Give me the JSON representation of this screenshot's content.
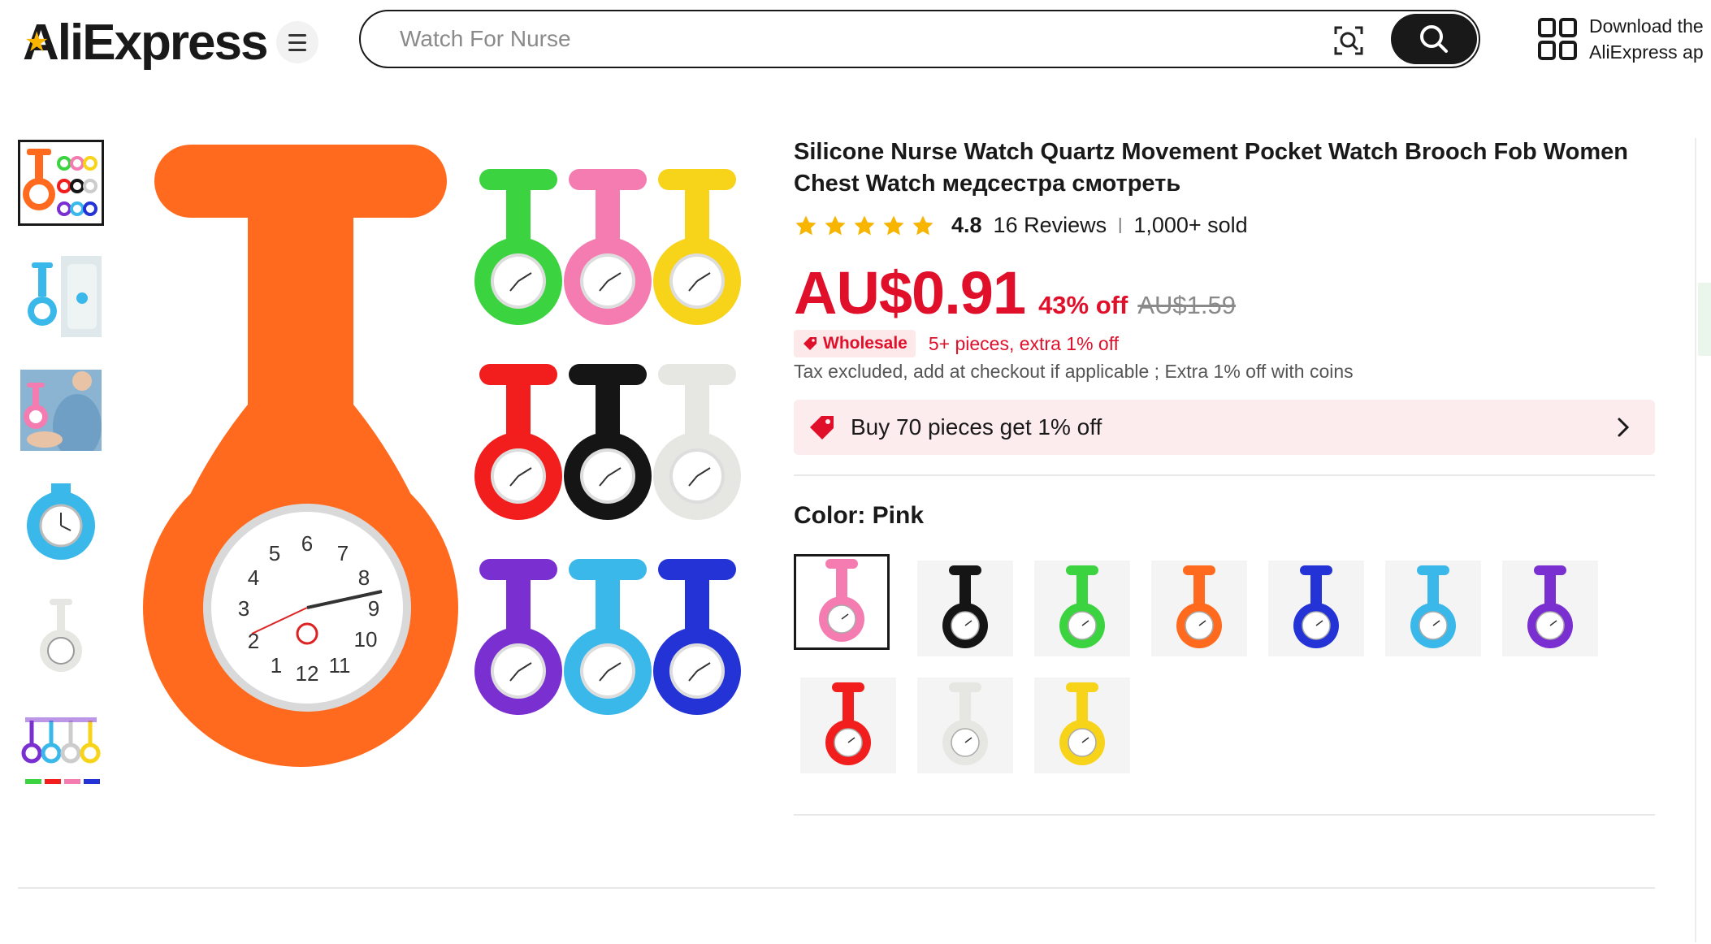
{
  "header": {
    "logo_text": "AliExpress",
    "search_placeholder": "Watch For Nurse",
    "download_line1": "Download the",
    "download_line2": "AliExpress ap"
  },
  "thumbnails": [
    {
      "name": "thumb-multi-watches",
      "active": true
    },
    {
      "name": "thumb-blue-watch-worn",
      "active": false
    },
    {
      "name": "thumb-pink-watch-worn",
      "active": false
    },
    {
      "name": "thumb-blue-watch",
      "active": false
    },
    {
      "name": "thumb-white-watch",
      "active": false
    },
    {
      "name": "thumb-watch-row",
      "active": false
    }
  ],
  "product": {
    "title": "Silicone Nurse Watch Quartz Movement Pocket Watch Brooch Fob Women Chest Watch медсестра смотреть",
    "rating": "4.8",
    "reviews": "16 Reviews",
    "sold": "1,000+ sold",
    "price": "AU$0.91",
    "discount": "43% off",
    "original_price": "AU$1.59",
    "wholesale_badge": "Wholesale",
    "wholesale_text": "5+ pieces, extra 1% off",
    "tax_text": "Tax excluded, add at checkout if applicable ; Extra 1% off with coins",
    "promo_text": "Buy 70 pieces get 1% off",
    "color_label": "Color: Pink"
  },
  "colors": {
    "accent_red": "#e0102b",
    "star": "#f7b500",
    "options": [
      {
        "name": "pink",
        "hex": "#f47cb0",
        "selected": true
      },
      {
        "name": "black",
        "hex": "#151515",
        "selected": false
      },
      {
        "name": "green",
        "hex": "#3bd33f",
        "selected": false
      },
      {
        "name": "orange",
        "hex": "#ff6a1e",
        "selected": false
      },
      {
        "name": "blue",
        "hex": "#2333d6",
        "selected": false
      },
      {
        "name": "sky-blue",
        "hex": "#3ab8ea",
        "selected": false
      },
      {
        "name": "purple",
        "hex": "#7a2fd1",
        "selected": false
      },
      {
        "name": "red",
        "hex": "#f21d1d",
        "selected": false
      },
      {
        "name": "white",
        "hex": "#e6e6e2",
        "selected": false
      },
      {
        "name": "yellow",
        "hex": "#f7d31a",
        "selected": false
      }
    ]
  }
}
